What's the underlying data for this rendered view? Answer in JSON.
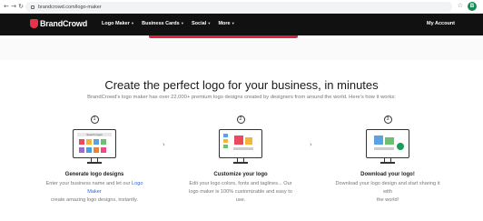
{
  "browser": {
    "url": "brandcrowd.com/logo-maker",
    "profile_initial": "B"
  },
  "header": {
    "brand": "BrandCrowd",
    "menu": [
      {
        "label": "Logo Maker"
      },
      {
        "label": "Business Cards"
      },
      {
        "label": "Social"
      },
      {
        "label": "More"
      }
    ],
    "account": "My Account"
  },
  "main": {
    "headline": "Create the perfect logo for your business, in minutes",
    "subline": "BrandCrowd's logo maker has over 22,000+ premium logo designs created by designers from around the world. Here's how it works:"
  },
  "steps": [
    {
      "number": "1",
      "screen_label": "Search logos",
      "title": "Generate logo designs",
      "desc_line1_pre": "Enter your business name and let our ",
      "desc_link": "Logo Maker",
      "desc_line2": "create amazing logo designs, instantly."
    },
    {
      "number": "2",
      "title": "Customize your logo",
      "desc_line1": "Edit your logo colors, fonts and taglines... Our",
      "desc_line2": "logo maker is 100% customizable and easy to use."
    },
    {
      "number": "3",
      "title": "Download your logo!",
      "desc_line1": "Download your logo design and start sharing it with",
      "desc_line2": "the world!"
    }
  ],
  "colors": {
    "header_bg": "#111111",
    "brand_red": "#e0203e",
    "link_blue": "#2b6bd8"
  }
}
